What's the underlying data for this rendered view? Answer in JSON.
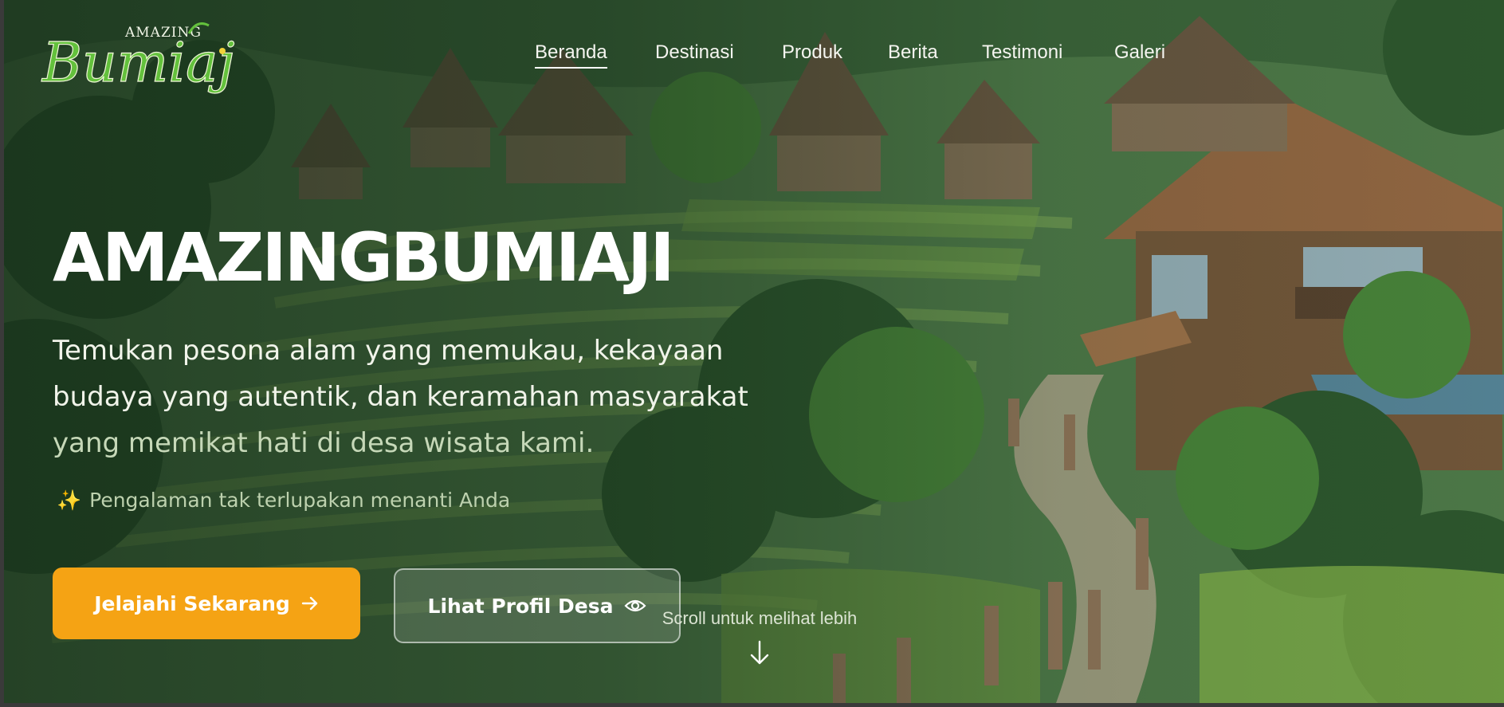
{
  "logo": {
    "top_text": "AMAZING",
    "main_text": "Bumiaji",
    "colors": {
      "green": "#63c13c",
      "yellow": "#f0d23a",
      "outline": "#eef6d6"
    }
  },
  "nav": {
    "items": [
      {
        "label": "Beranda",
        "active": true
      },
      {
        "label": "Destinasi",
        "active": false
      },
      {
        "label": "Produk",
        "active": false
      },
      {
        "label": "Berita",
        "active": false
      },
      {
        "label": "Testimoni",
        "active": false
      },
      {
        "label": "Galeri",
        "active": false
      }
    ]
  },
  "hero": {
    "title": "AMAZINGBUMIAJI",
    "description_lines": [
      "Temukan pesona alam yang memukau, kekayaan",
      "budaya yang autentik, dan keramahan masyarakat",
      "yang memikat hati di desa wisata kami."
    ],
    "tagline_icon": "sparkles-icon",
    "tagline_emoji": "✨",
    "tagline": "Pengalaman tak terlupakan menanti Anda",
    "primary_button": {
      "label": "Jelajahi Sekarang",
      "icon": "arrow-right-icon"
    },
    "secondary_button": {
      "label": "Lihat Profil Desa",
      "icon": "eye-icon"
    },
    "scroll_hint": "Scroll untuk melihat lebih",
    "scroll_icon": "arrow-down-icon"
  },
  "colors": {
    "accent": "#f5a314",
    "text": "#ffffff",
    "overlay": "#12281a",
    "background": "#3a3a3a"
  }
}
